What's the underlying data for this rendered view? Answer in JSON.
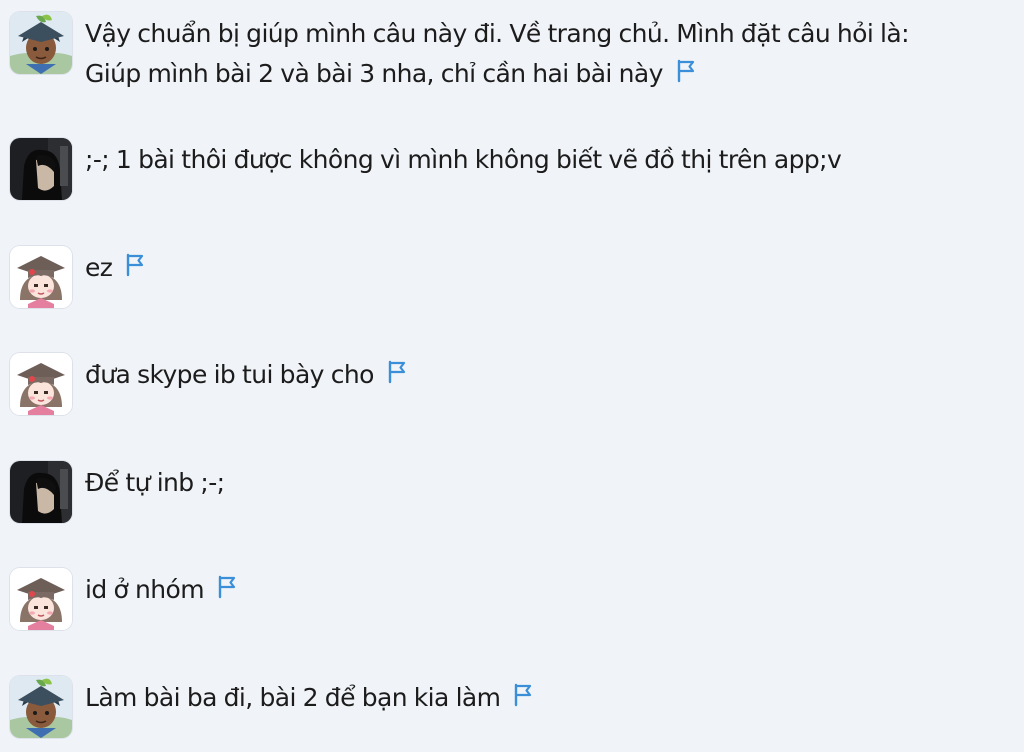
{
  "colors": {
    "background": "#f0f3f8",
    "text": "#1c1c1c",
    "flag": "#3b8fd9"
  },
  "messages": [
    {
      "avatar": "green-hat-boy-avatar",
      "line1": "Vậy chuẩn bị giúp mình câu này đi. Về trang chủ. Mình đặt câu hỏi là:",
      "line2": "Giúp mình bài 2 và bài 3 nha, chỉ cần hai bài này",
      "report_icon": "flag-icon"
    },
    {
      "avatar": "dark-hair-girl-avatar",
      "line1": ";-; 1 bài thôi được không vì mình không biết vẽ đồ thị trên app;v"
    },
    {
      "avatar": "graduate-girl-avatar",
      "line1": "ez",
      "report_icon": "flag-icon"
    },
    {
      "avatar": "graduate-girl-avatar",
      "line1": "đưa skype ib tui bày cho",
      "report_icon": "flag-icon"
    },
    {
      "avatar": "dark-hair-girl-avatar",
      "line1": "Để tự inb ;-;"
    },
    {
      "avatar": "graduate-girl-avatar",
      "line1": "id ở nhóm",
      "report_icon": "flag-icon"
    },
    {
      "avatar": "green-hat-boy-avatar",
      "line1": "Làm bài ba đi, bài 2 để bạn kia làm",
      "report_icon": "flag-icon"
    }
  ]
}
